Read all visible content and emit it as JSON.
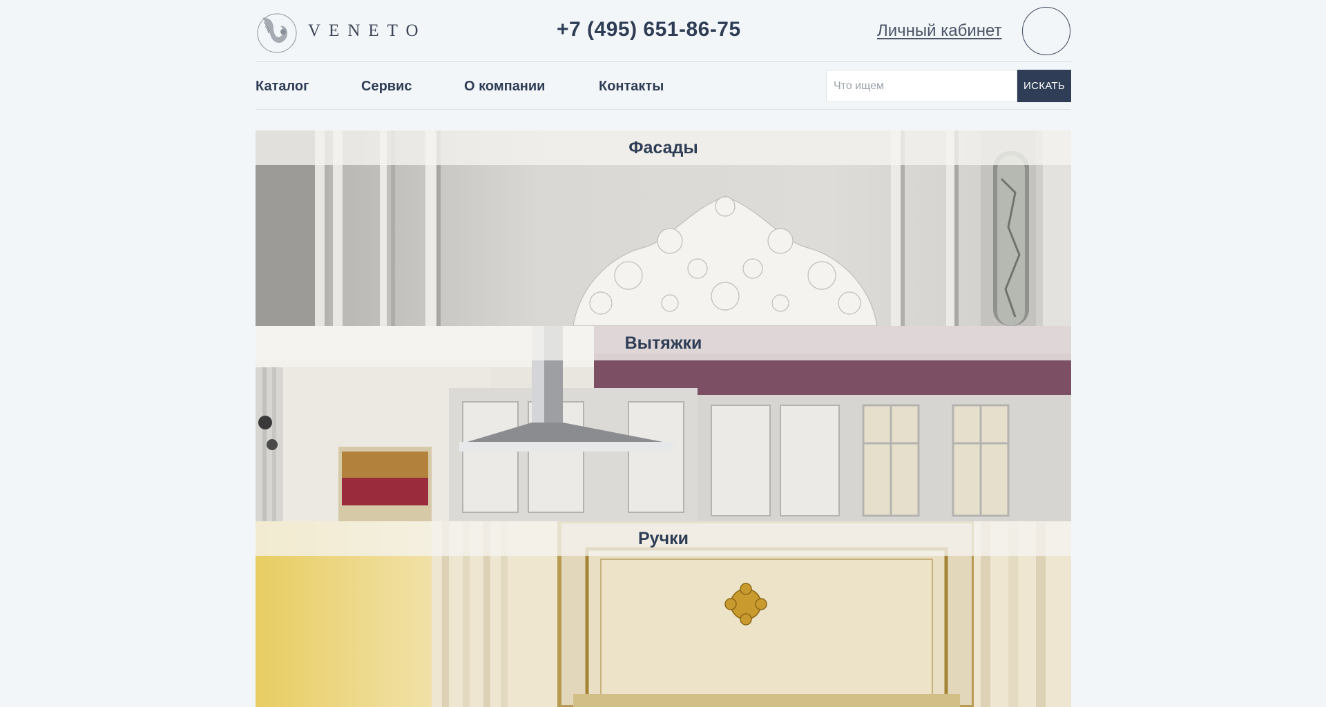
{
  "brand": {
    "name": "VENETO"
  },
  "header": {
    "phone": "+7 (495) 651-86-75",
    "cabinet_link": "Личный кабинет"
  },
  "nav": {
    "items": [
      {
        "label": "Каталог"
      },
      {
        "label": "Сервис"
      },
      {
        "label": "О компании"
      },
      {
        "label": "Контакты"
      }
    ]
  },
  "search": {
    "placeholder": "Что ищем",
    "value": "",
    "button_label": "ИСКАТЬ"
  },
  "categories": [
    {
      "title": "Фасады"
    },
    {
      "title": "Вытяжки"
    },
    {
      "title": "Ручки"
    }
  ],
  "colors": {
    "page_bg": "#f3f6f9",
    "text_dark": "#2e3d55",
    "button_bg": "#2f3e56"
  }
}
